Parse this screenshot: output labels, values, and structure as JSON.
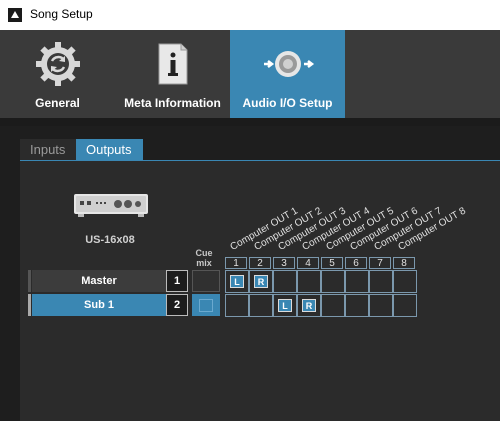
{
  "window": {
    "title": "Song Setup"
  },
  "toolbar": {
    "items": [
      {
        "label": "General",
        "icon": "gear-refresh-icon"
      },
      {
        "label": "Meta Information",
        "icon": "document-info-icon"
      },
      {
        "label": "Audio I/O Setup",
        "icon": "speaker-io-icon",
        "active": true
      }
    ]
  },
  "subtabs": {
    "inputs": "Inputs",
    "outputs": "Outputs",
    "active": "Outputs"
  },
  "device": {
    "name": "US-16x08",
    "icon": "audio-interface-icon"
  },
  "matrix": {
    "cue_label_line1": "Cue",
    "cue_label_line2": "mix",
    "columns": [
      {
        "label": "Computer OUT 1",
        "num": "1"
      },
      {
        "label": "Computer OUT 2",
        "num": "2"
      },
      {
        "label": "Computer OUT 3",
        "num": "3"
      },
      {
        "label": "Computer OUT 4",
        "num": "4"
      },
      {
        "label": "Computer OUT 5",
        "num": "5"
      },
      {
        "label": "Computer OUT 6",
        "num": "6"
      },
      {
        "label": "Computer OUT 7",
        "num": "7"
      },
      {
        "label": "Computer OUT 8",
        "num": "8"
      }
    ],
    "rows": [
      {
        "name": "Master",
        "num": "1",
        "selected": false,
        "assign": {
          "1": "L",
          "2": "R"
        }
      },
      {
        "name": "Sub 1",
        "num": "2",
        "selected": true,
        "assign": {
          "3": "L",
          "4": "R"
        }
      }
    ]
  },
  "colors": {
    "accent": "#3a87b3",
    "toolbar_bg": "#3a3a3a",
    "content_bg": "#2b2b2b"
  }
}
